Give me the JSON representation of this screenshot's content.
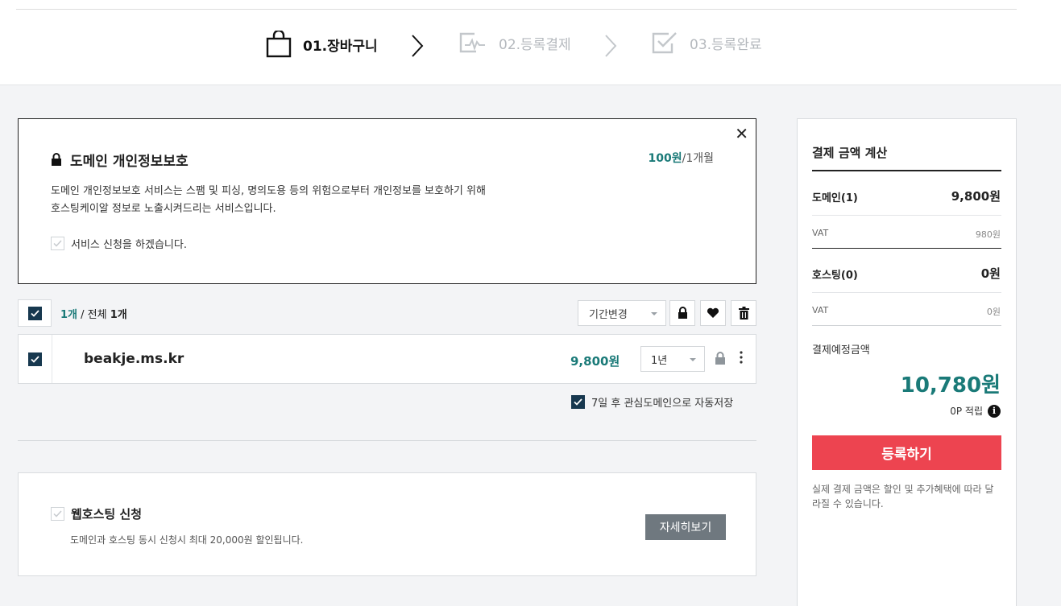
{
  "steps": [
    {
      "label": "01.장바구니",
      "state": "active",
      "icon": "shopping-bag-icon"
    },
    {
      "label": "02.등록결제",
      "state": "inactive",
      "icon": "payment-card-icon"
    },
    {
      "label": "03.등록완료",
      "state": "inactive",
      "icon": "check-box-icon"
    }
  ],
  "privacy": {
    "title": "도메인 개인정보보호",
    "price_value": "100원",
    "price_unit": "/1개월",
    "desc_line1": "도메인 개인정보보호 서비스는 스팸 및 피싱, 명의도용 등의 위험으로부터 개인정보를 보호하기 위해",
    "desc_line2": "호스팅케이알 정보로 노출시켜드리는 서비스입니다.",
    "apply_label": "서비스 신청을 하겠습니다.",
    "close_glyph": "✕"
  },
  "list": {
    "selected": "1개",
    "separator": " / 전체 ",
    "total": "1개",
    "period_label": "기간변경"
  },
  "domain_row": {
    "name": "beakje.ms.kr",
    "price": "9,800원",
    "period": "1년"
  },
  "autosave_label": "7일 후 관심도메인으로 자동저장",
  "hosting": {
    "title": "웹호스팅 신청",
    "desc": "도메인과 호스팅 동시 신청시 최대 20,000원 할인됩니다.",
    "detail_label": "자세히보기"
  },
  "summary": {
    "title": "결제 금액 계산",
    "domain_label": "도메인(1)",
    "domain_value": "9,800원",
    "vat_label": "VAT",
    "domain_vat": "980원",
    "hosting_label": "호스팅(0)",
    "hosting_value": "0원",
    "hosting_vat": "0원",
    "total_label": "결제예정금액",
    "total_value": "10,780원",
    "points": "0P 적립",
    "info_glyph": "i",
    "register_label": "등록하기",
    "note": "실제 결제 금액은 할인 및 추가혜택에 따라 달라질 수 있습니다."
  },
  "colors": {
    "accent": "#1a7a78",
    "register": "#ed4450",
    "checkbox": "#17384f"
  }
}
